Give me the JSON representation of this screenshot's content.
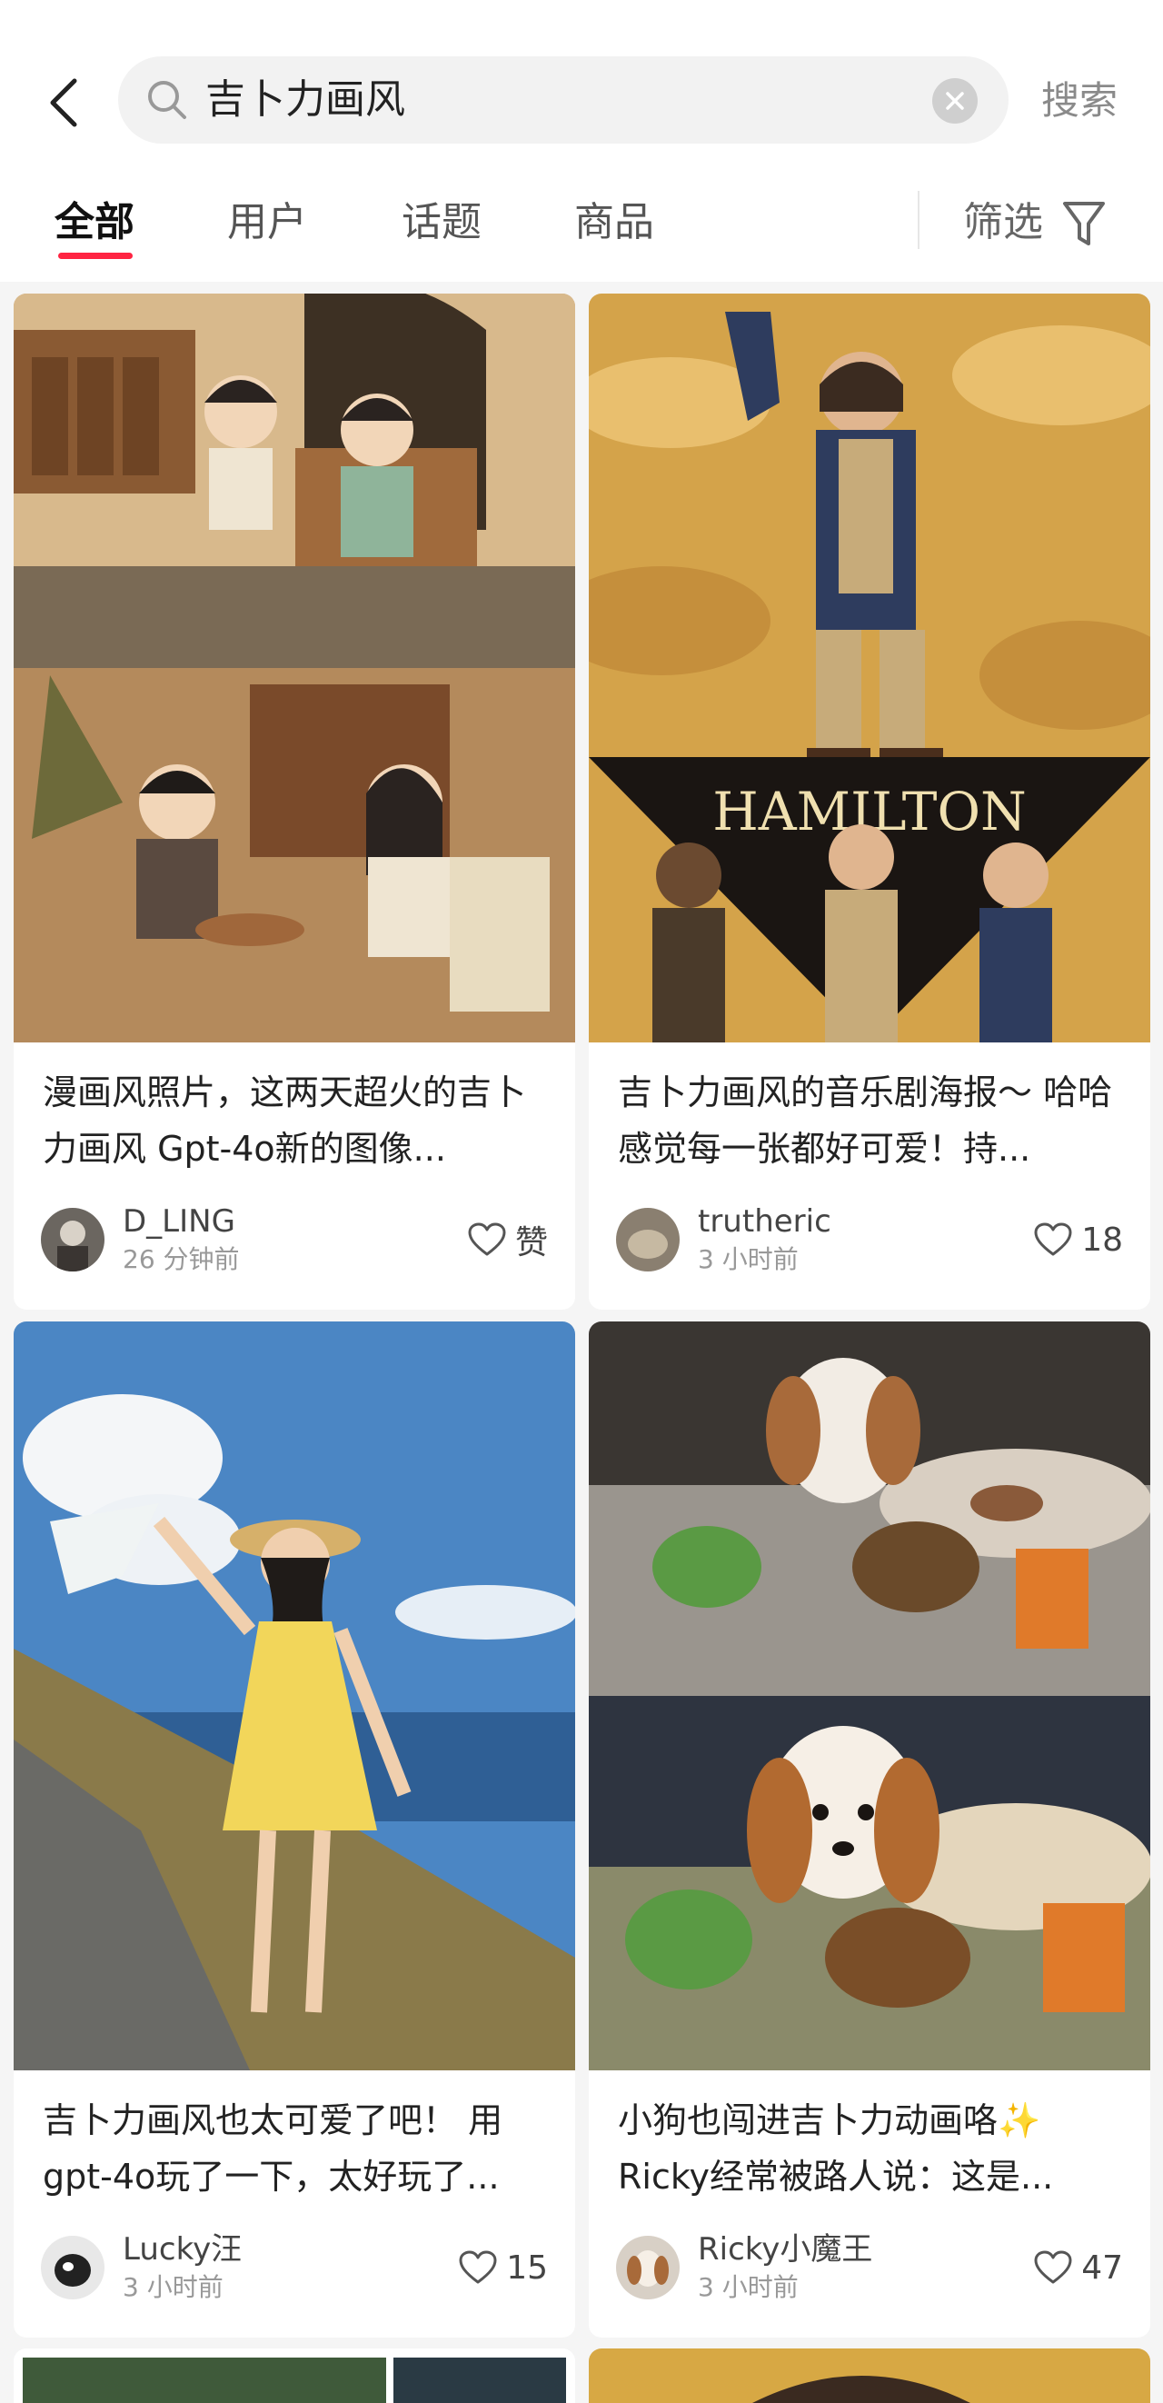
{
  "search": {
    "query": "吉卜力画风",
    "submit_label": "搜索"
  },
  "tabs": [
    {
      "label": "全部",
      "active": true
    },
    {
      "label": "用户",
      "active": false
    },
    {
      "label": "话题",
      "active": false
    },
    {
      "label": "商品",
      "active": false
    }
  ],
  "filter_label": "筛选",
  "posts": [
    {
      "title": "漫画风照片，这两天超火的吉卜力画风 Gpt-4o新的图像...",
      "author": "D_LING",
      "time": "26 分钟前",
      "likes": "赞",
      "image": "ghibli-style-family-photo"
    },
    {
      "title": "吉卜力画风的音乐剧海报～ 哈哈感觉每一张都好可爱！持...",
      "author": "trutheric",
      "time": "3 小时前",
      "likes": "18",
      "image": "hamilton-musical-poster",
      "image_text": "HAMILTON"
    },
    {
      "title": "吉卜力画风也太可爱了吧！ 用gpt-4o玩了一下，太好玩了...",
      "author": "Lucky汪",
      "time": "3 小时前",
      "likes": "15",
      "image": "girl-in-yellow-dress-seaside"
    },
    {
      "title": "小狗也闯进吉卜力动画咯✨ Ricky经常被路人说：这是...",
      "author": "Ricky小魔王",
      "time": "3 小时前",
      "likes": "47",
      "image": "cavalier-spaniel-with-toys"
    }
  ],
  "colors": {
    "accent": "#ff2442",
    "background": "#f5f5f5"
  }
}
